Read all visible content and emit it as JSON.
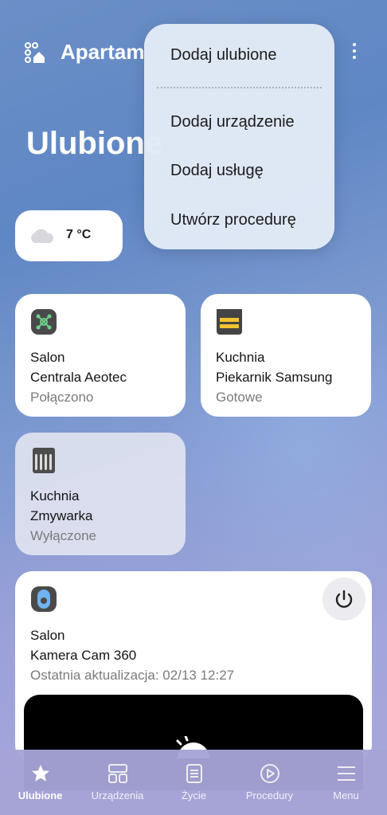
{
  "header": {
    "home_title": "Apartam",
    "page_title": "Ulubione"
  },
  "menu": {
    "items": [
      "Dodaj ulubione",
      "Dodaj urządzenie",
      "Dodaj usługę",
      "Utwórz procedurę"
    ]
  },
  "weather": {
    "temperature": "7 °C",
    "icon": "cloud-icon"
  },
  "devices": [
    {
      "room": "Salon",
      "name": "Centrala Aeotec",
      "status": "Połączono",
      "icon": "hub-icon"
    },
    {
      "room": "Kuchnia",
      "name": "Piekarnik Samsung",
      "status": "Gotowe",
      "icon": "oven-icon"
    },
    {
      "room": "Kuchnia",
      "name": "Zmywarka",
      "status": "Wyłączone",
      "icon": "dishwasher-icon"
    },
    {
      "room": "Salon",
      "name": "Kamera Cam 360",
      "status": "Ostatnia aktualizacja: 02/13 12:27",
      "icon": "camera-icon"
    }
  ],
  "nav": [
    {
      "label": "Ulubione",
      "icon": "star-icon",
      "active": true
    },
    {
      "label": "Urządzenia",
      "icon": "devices-icon",
      "active": false
    },
    {
      "label": "Życie",
      "icon": "life-icon",
      "active": false
    },
    {
      "label": "Procedury",
      "icon": "play-icon",
      "active": false
    },
    {
      "label": "Menu",
      "icon": "menu-icon",
      "active": false
    }
  ],
  "colors": {
    "hub_bg": "#4a4a4a",
    "hub_accent": "#6cd08a",
    "oven_yellow": "#f2c230",
    "camera_blue": "#6fb3f0"
  }
}
